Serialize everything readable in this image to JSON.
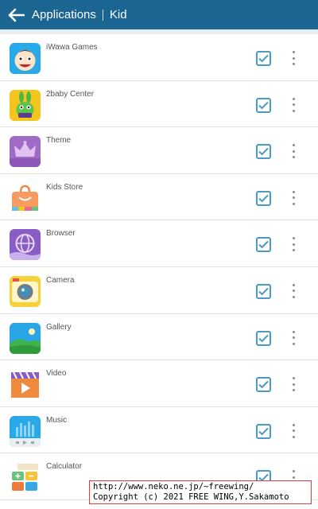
{
  "appbar": {
    "back_icon": "arrow-left-icon",
    "title_left": "Applications",
    "title_right": "Kid",
    "color": "#1a6591"
  },
  "apps": [
    {
      "name": "iWawa Games",
      "icon": "iwawa-games-icon",
      "checked": true
    },
    {
      "name": "2baby Center",
      "icon": "2baby-center-icon",
      "checked": true
    },
    {
      "name": "Theme",
      "icon": "theme-crown-icon",
      "checked": true
    },
    {
      "name": "Kids Store",
      "icon": "kids-store-bag-icon",
      "checked": true
    },
    {
      "name": "Browser",
      "icon": "browser-globe-icon",
      "checked": true
    },
    {
      "name": "Camera",
      "icon": "camera-icon",
      "checked": true
    },
    {
      "name": "Gallery",
      "icon": "gallery-landscape-icon",
      "checked": true
    },
    {
      "name": "Video",
      "icon": "video-play-icon",
      "checked": true
    },
    {
      "name": "Music",
      "icon": "music-player-icon",
      "checked": true
    },
    {
      "name": "Calculator",
      "icon": "calculator-icon",
      "checked": true
    }
  ],
  "credit": {
    "line1": "http://www.neko.ne.jp/~freewing/",
    "line2": "Copyright (c) 2021 FREE WING,Y.Sakamoto"
  },
  "accent": "#4a9bc4"
}
